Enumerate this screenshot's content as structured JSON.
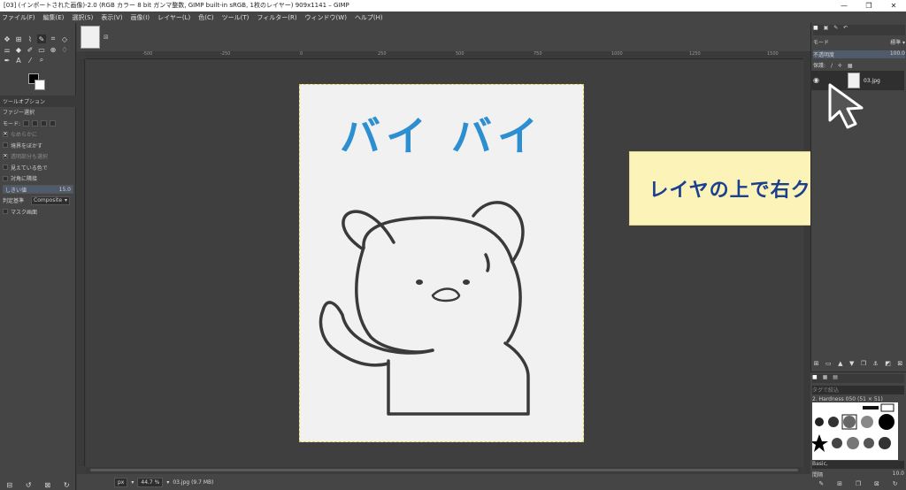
{
  "window": {
    "title": "[03] (インポートされた画像)-2.0 (RGB カラー 8 bit ガンマ整数, GIMP built-in sRGB, 1枚のレイヤー) 909x1141 – GIMP",
    "controls": [
      "—",
      "❐",
      "✕"
    ]
  },
  "menu": [
    "ファイル(F)",
    "編集(E)",
    "選択(S)",
    "表示(V)",
    "画像(I)",
    "レイヤー(L)",
    "色(C)",
    "ツール(T)",
    "フィルター(R)",
    "ウィンドウ(W)",
    "ヘルプ(H)"
  ],
  "toolbox": {
    "tool_options_title": "ツールオプション",
    "tool_name": "ファジー選択",
    "mode_label": "モード:",
    "options": [
      {
        "label": "なめらかに",
        "checked": true
      },
      {
        "label": "境界をぼかす",
        "checked": false
      },
      {
        "label": "透明部分も選択",
        "checked": true
      },
      {
        "label": "見えている色で",
        "checked": false
      },
      {
        "label": "対角に隣接",
        "checked": false
      }
    ],
    "threshold_label": "しきい値",
    "threshold_value": "15.0",
    "criterion_label": "判定基準",
    "criterion_value": "Composite",
    "mask_label": "マスク画面"
  },
  "canvas": {
    "ruler_labels": [
      "-500",
      "-250",
      "0",
      "250",
      "500",
      "750",
      "1000",
      "1250",
      "1500"
    ],
    "paper_text": "バイ バイ"
  },
  "statusbar": {
    "unit": "px",
    "zoom": "44.7 %",
    "file_info": "03.jpg (9.7 MB)"
  },
  "callout": {
    "text": "レイヤの上で右クリック"
  },
  "layers_panel": {
    "mode_label": "モード",
    "mode_value": "標準",
    "opacity_label": "不透明度",
    "opacity_value": "100.0",
    "lock_label": "保護:",
    "layer_name": "03.jpg"
  },
  "brushes_panel": {
    "filter_placeholder": "タグで絞込",
    "brush_name": "2. Hardness 050 (51 × 51)",
    "preset": "Basic,",
    "spacing_label": "間隔",
    "spacing_value": "10.0"
  }
}
